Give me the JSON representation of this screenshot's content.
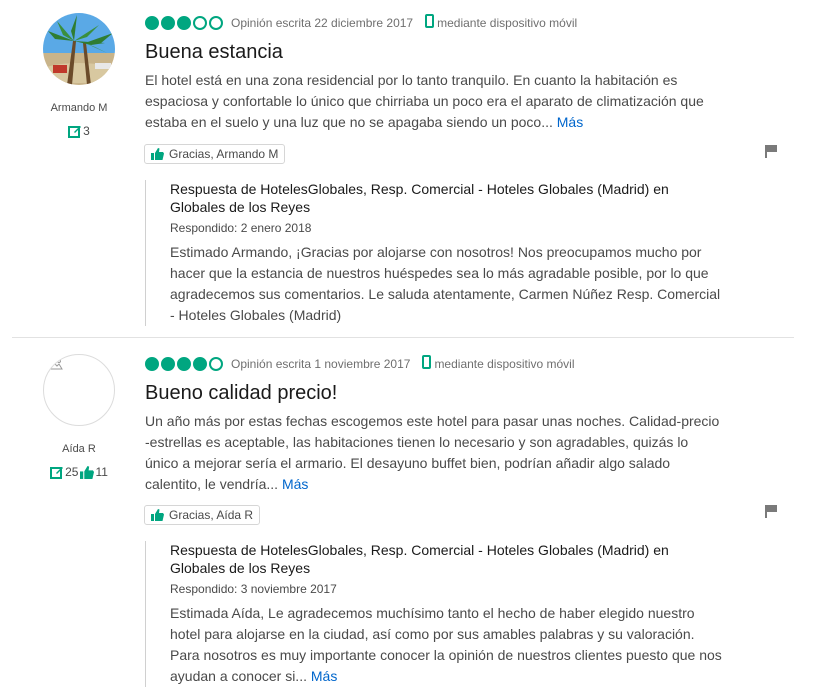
{
  "reviews": [
    {
      "username": "Armando M",
      "contributions": "3",
      "helpful_votes": "",
      "rating": 3,
      "date_text": "Opinión escrita 22 diciembre 2017",
      "device_text": "mediante dispositivo móvil",
      "title": "Buena estancia",
      "body": "El hotel está en una zona residencial por lo tanto tranquilo. En cuanto la habitación es espaciosa y confortable lo único que chirriaba un poco era el aparato de climatización que estaba en el suelo y una luz que no se apagaba siendo un poco...",
      "more_label": "Más",
      "thanks_label": "Gracias, Armando M",
      "response": {
        "header": "Respuesta de HotelesGlobales, Resp. Comercial - Hoteles Globales (Madrid) en Globales de los Reyes",
        "date": "Respondido: 2 enero 2018",
        "body": "Estimado Armando, ¡Gracias por alojarse con nosotros! Nos preocupamos mucho por hacer que la estancia de nuestros huéspedes sea lo más agradable posible, por lo que agradecemos sus comentarios. Le saluda atentamente, Carmen Núñez Resp. Comercial - Hoteles Globales (Madrid)",
        "more_label": ""
      }
    },
    {
      "username": "Aída R",
      "contributions": "25",
      "helpful_votes": "11",
      "rating": 4,
      "date_text": "Opinión escrita 1 noviembre 2017",
      "device_text": "mediante dispositivo móvil",
      "title": "Bueno calidad precio!",
      "body": "Un año más por estas fechas escogemos este hotel para pasar unas noches. Calidad-precio -estrellas es aceptable, las habitaciones tienen lo necesario y son agradables, quizás lo único a mejorar sería el armario. El desayuno buffet bien, podrían añadir algo salado calentito, le vendría...",
      "more_label": "Más",
      "thanks_label": "Gracias, Aída R",
      "response": {
        "header": "Respuesta de HotelesGlobales, Resp. Comercial - Hoteles Globales (Madrid) en Globales de los Reyes",
        "date": "Respondido: 3 noviembre 2017",
        "body": "Estimada Aída, Le agradecemos muchísimo tanto el hecho de haber elegido nuestro hotel para alojarse en la ciudad, así como por sus amables palabras y su valoración. Para nosotros es muy importante conocer la opinión de nuestros clientes puesto que nos ayudan a conocer si...",
        "more_label": "Más"
      }
    }
  ],
  "colors": {
    "brand_green": "#00a680",
    "link_blue": "#0066cc"
  },
  "icons": {
    "avatar_1": "palm-beach-photo",
    "avatar_2": "placeholder-image-icon",
    "contributions": "pencil-review-icon",
    "helpful": "thumbs-up-icon",
    "device": "mobile-phone-icon",
    "flag": "flag-icon"
  }
}
